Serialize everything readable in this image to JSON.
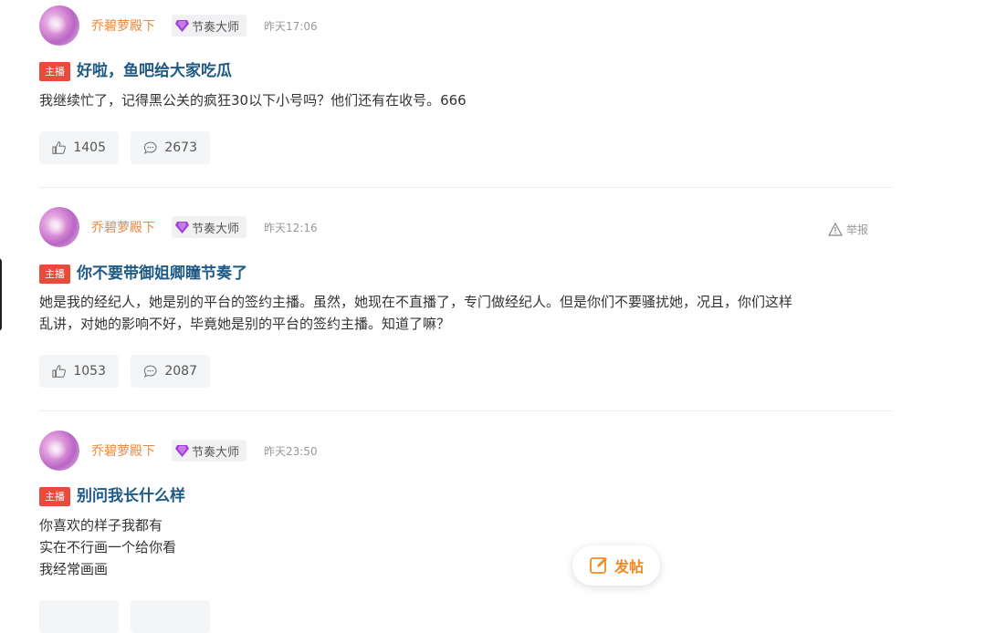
{
  "posts": [
    {
      "username": "乔碧萝殿下",
      "badge": "节奏大师",
      "time": "昨天17:06",
      "tag": "主播",
      "title": "好啦，鱼吧给大家吃瓜",
      "body": [
        "我继续忙了，记得黑公关的疯狂30以下小号吗？他们还有在收号。666"
      ],
      "likes": "1405",
      "comments": "2673"
    },
    {
      "username": "乔碧萝殿下",
      "badge": "节奏大师",
      "time": "昨天12:16",
      "report": "举报",
      "tag": "主播",
      "title": "你不要带御姐卿瞳节奏了",
      "body": [
        "她是我的经纪人，她是别的平台的签约主播。虽然，她现在不直播了，专门做经纪人。但是你们不要骚扰她，况且，你们这样",
        "乱讲，对她的影响不好，毕竟她是别的平台的签约主播。知道了嘛？"
      ],
      "likes": "1053",
      "comments": "2087"
    },
    {
      "username": "乔碧萝殿下",
      "badge": "节奏大师",
      "time": "昨天23:50",
      "tag": "主播",
      "title": "别问我长什么样",
      "body": [
        "你喜欢的样子我都有",
        "实在不行画一个给你看",
        "我经常画画"
      ]
    }
  ],
  "fab": {
    "label": "发帖"
  },
  "colors": {
    "accent": "#f08a24",
    "username": "#e88a43",
    "title": "#1f5a84",
    "tag": "#e74b3c"
  }
}
